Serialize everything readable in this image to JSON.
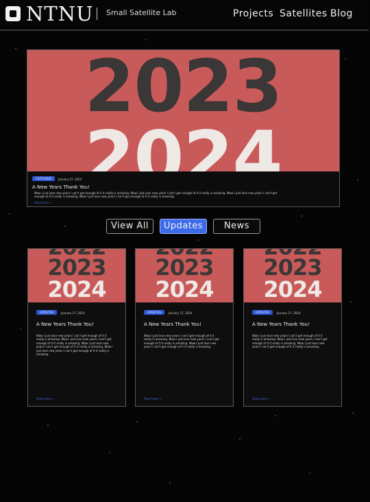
{
  "header": {
    "brand": "NTNU",
    "subtitle": "Small Satellite Lab",
    "nav": [
      "Projects",
      "Satellites",
      "Blog"
    ]
  },
  "banner_years": [
    "2022",
    "2023",
    "2024"
  ],
  "featured": {
    "tag": "FEATURED",
    "date": "January 27, 2024",
    "title": "A New Years Thank You!",
    "body": "Wow I just love new years I can't get enough of it it really is amazing. Wow I just love new years I can't get enough of it it really is amazing. Wow I just love new years I can't get enough of it it really is amazing. Wow I just love new years I can't get enough of it it really is amazing.",
    "read_more": "Read more →"
  },
  "filters": {
    "view_all": "View All",
    "updates": "Updates",
    "news": "News",
    "active": "Updates"
  },
  "cards": [
    {
      "tag": "UPDATES",
      "date": "January 27, 2024",
      "title": "A New Years Thank You!",
      "body": "Wow I just love new years I can't get enough of it it really is amazing. Wow I just love new years I can't get enough of it it really is amazing. Wow I just love new years I can't get enough of it it really is amazing. Wow I just love new years I can't get enough of it it really is amazing.",
      "read_more": "Read more →"
    },
    {
      "tag": "UPDATES",
      "date": "January 27, 2024",
      "title": "A New Years Thank You!",
      "body": "Wow I just love new years I can't get enough of it it really is amazing. Wow I just love new years I can't get enough of it it really is amazing. Wow I just love new years I can't get enough of it it really is amazing.",
      "read_more": "Read more →"
    },
    {
      "tag": "UPDATES",
      "date": "January 27, 2024",
      "title": "A New Years Thank You!",
      "body": "Wow I just love new years I can't get enough of it it really is amazing. Wow I just love new years I can't get enough of it it really is amazing. Wow I just love new years I can't get enough of it it really is amazing.",
      "read_more": "Read more →"
    }
  ],
  "colors": {
    "accent": "#3b6bea",
    "banner": "#c85b5a",
    "banner_dark_text": "#3a3736",
    "banner_light_text": "#efe9e6",
    "background": "#050505"
  }
}
